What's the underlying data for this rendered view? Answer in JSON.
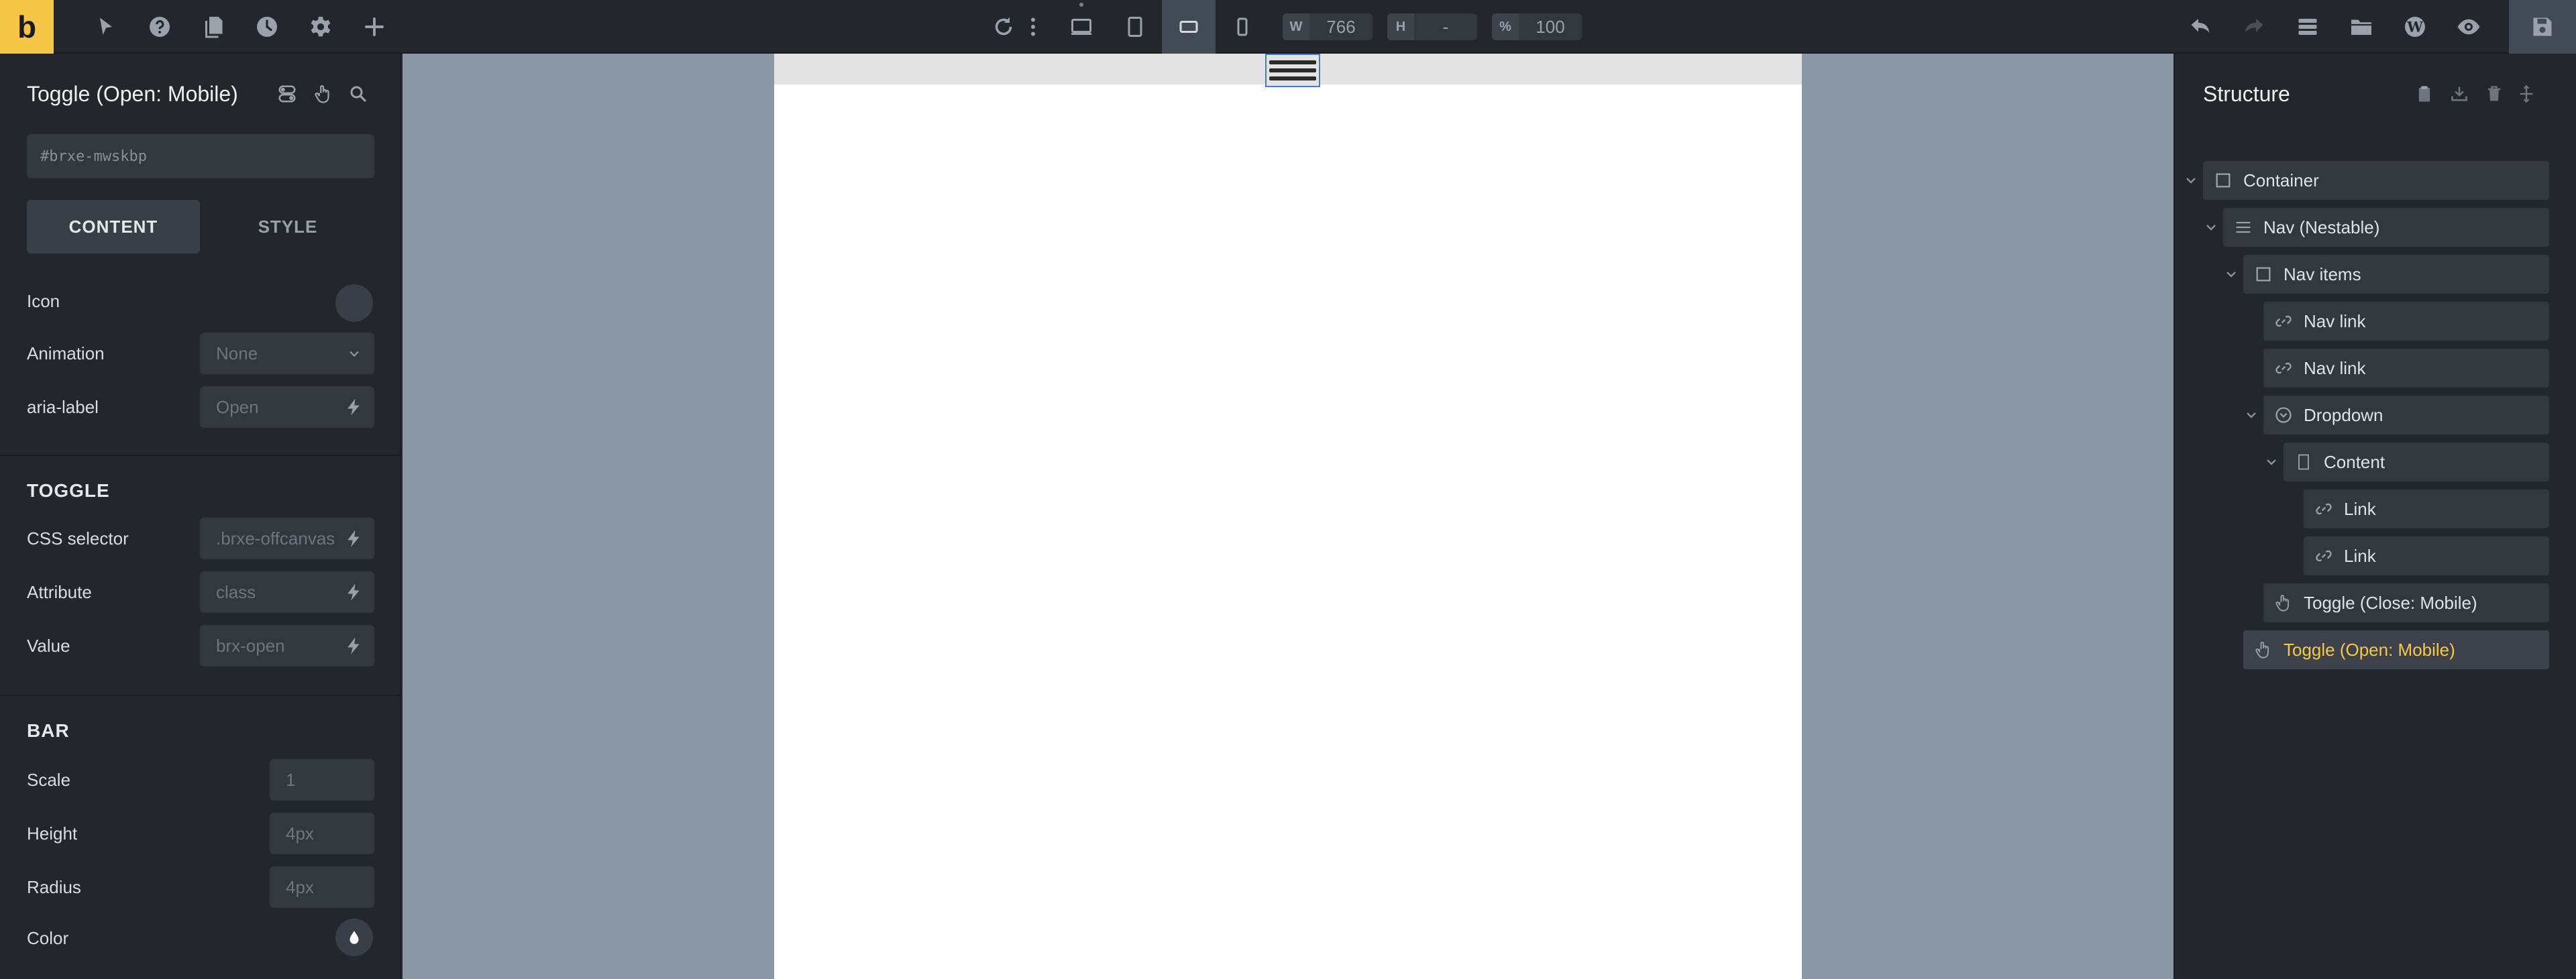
{
  "brand": {
    "logo_letter": "b",
    "accent": "#f7c646"
  },
  "topbar": {
    "left_icons": [
      "cursor-icon",
      "help-icon",
      "pages-icon",
      "history-icon",
      "settings-icon",
      "add-icon"
    ],
    "breakpoints": [
      "desktop",
      "tablet-portrait",
      "mobile-landscape",
      "mobile-portrait"
    ],
    "active_breakpoint": "mobile-landscape",
    "width_label": "W",
    "width_value": "766",
    "height_label": "H",
    "height_value": "-",
    "zoom_label": "%",
    "zoom_value": "100",
    "right_icons": [
      "undo-icon",
      "redo-icon",
      "structure-icon",
      "folder-icon",
      "wordpress-icon",
      "preview-icon",
      "save-icon"
    ]
  },
  "left_panel": {
    "title": "Toggle (Open: Mobile)",
    "css_id_placeholder": "#brxe-mwskbp",
    "tabs": [
      {
        "label": "CONTENT",
        "active": true
      },
      {
        "label": "STYLE",
        "active": false
      }
    ],
    "content": {
      "icon_label": "Icon",
      "animation_label": "Animation",
      "animation_value": "None",
      "aria_label": "aria-label",
      "aria_value": "Open"
    },
    "toggle_section": {
      "heading": "TOGGLE",
      "css_selector_label": "CSS selector",
      "css_selector_value": ".brxe-offcanvas",
      "attribute_label": "Attribute",
      "attribute_value": "class",
      "value_label": "Value",
      "value_value": "brx-open"
    },
    "bar_section": {
      "heading": "BAR",
      "scale_label": "Scale",
      "scale_value": "1",
      "height_label": "Height",
      "height_value": "4px",
      "radius_label": "Radius",
      "radius_value": "4px",
      "color_label": "Color"
    }
  },
  "structure": {
    "title": "Structure",
    "selected_color": "#f5c84c",
    "items": [
      {
        "label": "Container",
        "icon": "container-icon",
        "depth": 0,
        "expanded": true
      },
      {
        "label": "Nav (Nestable)",
        "icon": "menu-icon",
        "depth": 1,
        "expanded": true
      },
      {
        "label": "Nav items",
        "icon": "container-icon",
        "depth": 2,
        "expanded": true
      },
      {
        "label": "Nav link",
        "icon": "link-icon",
        "depth": 3
      },
      {
        "label": "Nav link",
        "icon": "link-icon",
        "depth": 3
      },
      {
        "label": "Dropdown",
        "icon": "dropdown-icon",
        "depth": 3,
        "expanded": true
      },
      {
        "label": "Content",
        "icon": "block-icon",
        "depth": 4,
        "expanded": true
      },
      {
        "label": "Link",
        "icon": "link-icon",
        "depth": 5
      },
      {
        "label": "Link",
        "icon": "link-icon",
        "depth": 5
      },
      {
        "label": "Toggle (Close: Mobile)",
        "icon": "hand-icon",
        "depth": 3
      },
      {
        "label": "Toggle (Open: Mobile)",
        "icon": "hand-icon",
        "depth": 2,
        "selected": true
      }
    ]
  }
}
